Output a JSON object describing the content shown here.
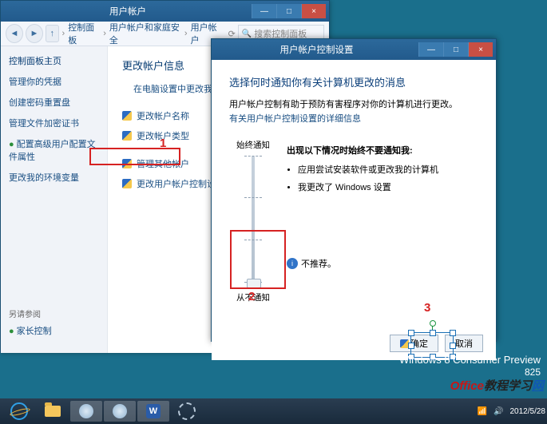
{
  "cp": {
    "title": "用户帐户",
    "sys": {
      "min": "—",
      "max": "□",
      "close": "×"
    },
    "breadcrumb": {
      "b1": "控制面板",
      "b2": "用户帐户和家庭安全",
      "b3": "用户帐户"
    },
    "search_ph": "搜索控制面板",
    "side": {
      "home": "控制面板主页",
      "items": [
        "管理你的凭据",
        "创建密码重置盘",
        "管理文件加密证书",
        "配置高级用户配置文件属性",
        "更改我的环境变量"
      ],
      "see_also": "另请参阅",
      "parental": "家长控制"
    },
    "main": {
      "heading": "更改帐户信息",
      "sub": "在电脑设置中更改我的帐户信息",
      "change_name": "更改帐户名称",
      "change_type": "更改帐户类型",
      "manage_other": "管理其他帐户",
      "change_uac": "更改用户帐户控制设置"
    }
  },
  "uac": {
    "title": "用户帐户控制设置",
    "h1": "选择何时通知你有关计算机更改的消息",
    "desc": "用户帐户控制有助于预防有害程序对你的计算机进行更改。",
    "more": "有关用户帐户控制设置的详细信息",
    "top": "始终通知",
    "bottom": "从不通知",
    "group": "出现以下情况时始终不要通知我:",
    "li1": "应用尝试安装软件或更改我的计算机",
    "li2": "我更改了 Windows 设置",
    "notrec": "不推荐。",
    "ok": "确定",
    "cancel": "取消"
  },
  "annot": {
    "a1": "1",
    "a2": "2",
    "a3": "3"
  },
  "desktop": {
    "wm1": "Windows 8 Consumer Preview",
    "wm2": "825",
    "site1": "Office",
    "site2": "教程学习",
    "site3": "网",
    "time": "2012/5/28"
  },
  "tb": {
    "w": "W"
  }
}
